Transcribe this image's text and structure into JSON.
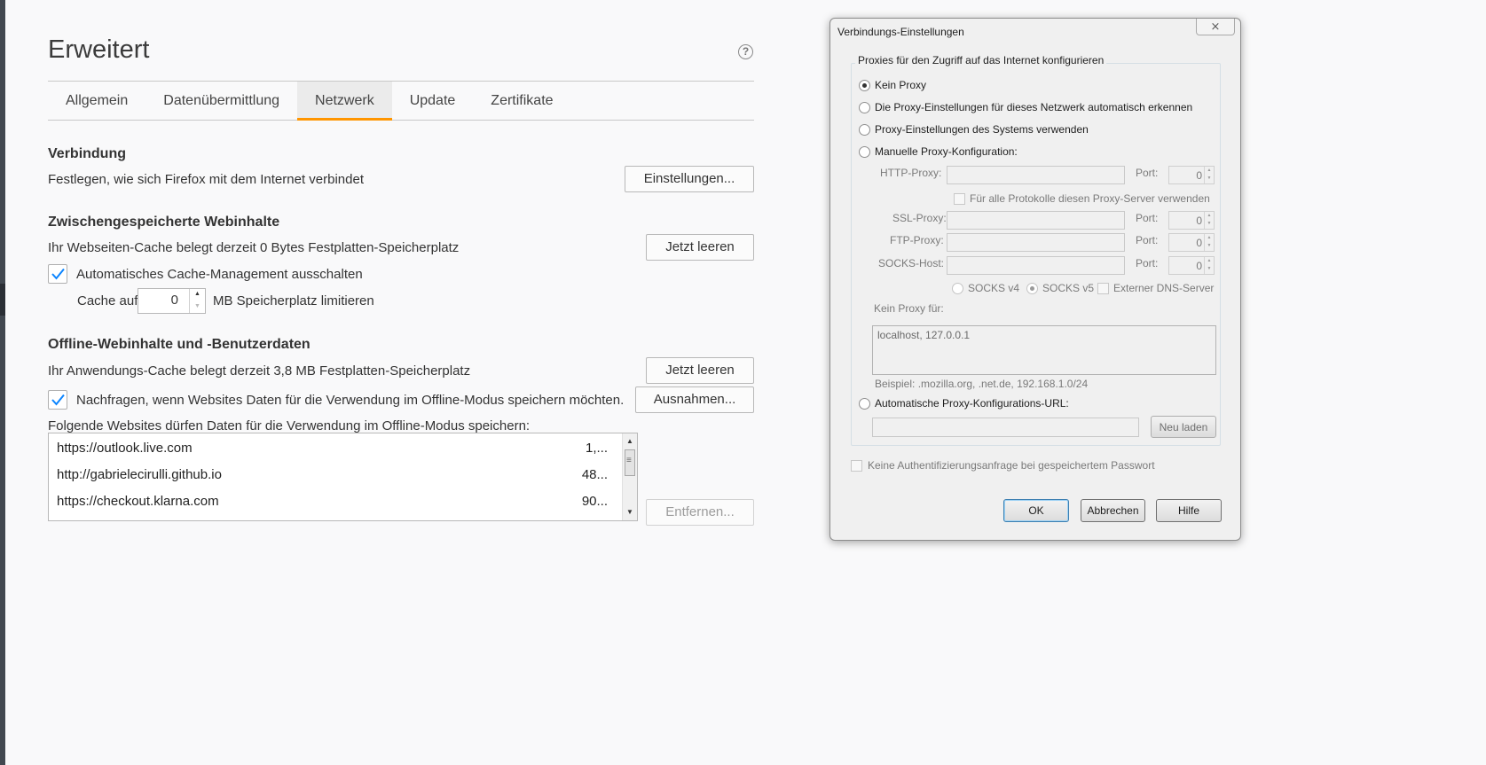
{
  "page": {
    "title": "Erweitert",
    "help_icon": "question-circle-icon"
  },
  "tabs": [
    {
      "label": "Allgemein",
      "active": false
    },
    {
      "label": "Datenübermittlung",
      "active": false
    },
    {
      "label": "Netzwerk",
      "active": true
    },
    {
      "label": "Update",
      "active": false
    },
    {
      "label": "Zertifikate",
      "active": false
    }
  ],
  "verbindung": {
    "title": "Verbindung",
    "description": "Festlegen, wie sich Firefox mit dem Internet verbindet",
    "button": "Einstellungen..."
  },
  "cache": {
    "title": "Zwischengespeicherte Webinhalte",
    "description": "Ihr Webseiten-Cache belegt derzeit 0 Bytes Festplatten-Speicherplatz",
    "clear_button": "Jetzt leeren",
    "auto_manage_label": "Automatisches Cache-Management ausschalten",
    "auto_manage_checked": true,
    "limit_prefix": "Cache auf",
    "limit_value": "0",
    "limit_suffix": "MB Speicherplatz limitieren"
  },
  "offline": {
    "title": "Offline-Webinhalte und -Benutzerdaten",
    "description": "Ihr Anwendungs-Cache belegt derzeit 3,8 MB Festplatten-Speicherplatz",
    "clear_button": "Jetzt leeren",
    "ask_label": "Nachfragen, wenn Websites Daten für die Verwendung im Offline-Modus speichern möchten.",
    "ask_checked": true,
    "exceptions_button": "Ausnahmen...",
    "list_caption": "Folgende Websites dürfen Daten für die Verwendung im Offline-Modus speichern:",
    "sites": [
      {
        "url": "https://outlook.live.com",
        "size": "1,..."
      },
      {
        "url": "http://gabrielecirulli.github.io",
        "size": "48..."
      },
      {
        "url": "https://checkout.klarna.com",
        "size": "90..."
      }
    ],
    "remove_button": "Entfernen..."
  },
  "dialog": {
    "title": "Verbindungs-Einstellungen",
    "close_label": "⨯",
    "group_label": "Proxies für den Zugriff auf das Internet konfigurieren",
    "options": {
      "no_proxy": "Kein Proxy",
      "auto_detect": "Die Proxy-Einstellungen für dieses Netzwerk automatisch erkennen",
      "system": "Proxy-Einstellungen des Systems verwenden",
      "manual": "Manuelle Proxy-Konfiguration:",
      "auto_url": "Automatische Proxy-Konfigurations-URL:"
    },
    "selected_option": "no_proxy",
    "http_label": "HTTP-Proxy:",
    "ssl_label": "SSL-Proxy:",
    "ftp_label": "FTP-Proxy:",
    "socks_label": "SOCKS-Host:",
    "port_label": "Port:",
    "http_port": "0",
    "ssl_port": "0",
    "ftp_port": "0",
    "socks_port": "0",
    "share_all_label": "Für alle Protokolle diesen Proxy-Server verwenden",
    "socks_v4": "SOCKS v4",
    "socks_v5": "SOCKS v5",
    "remote_dns": "Externer DNS-Server",
    "no_proxy_for_label": "Kein Proxy für:",
    "no_proxy_for_value": "localhost, 127.0.0.1",
    "example": "Beispiel: .mozilla.org, .net.de, 192.168.1.0/24",
    "reload_button": "Neu laden",
    "no_auth_prompt": "Keine Authentifizierungsanfrage bei gespeichertem Passwort",
    "ok": "OK",
    "cancel": "Abbrechen",
    "help": "Hilfe"
  },
  "colors": {
    "accent": "#ff9500",
    "checkmark": "#0a84ff"
  }
}
